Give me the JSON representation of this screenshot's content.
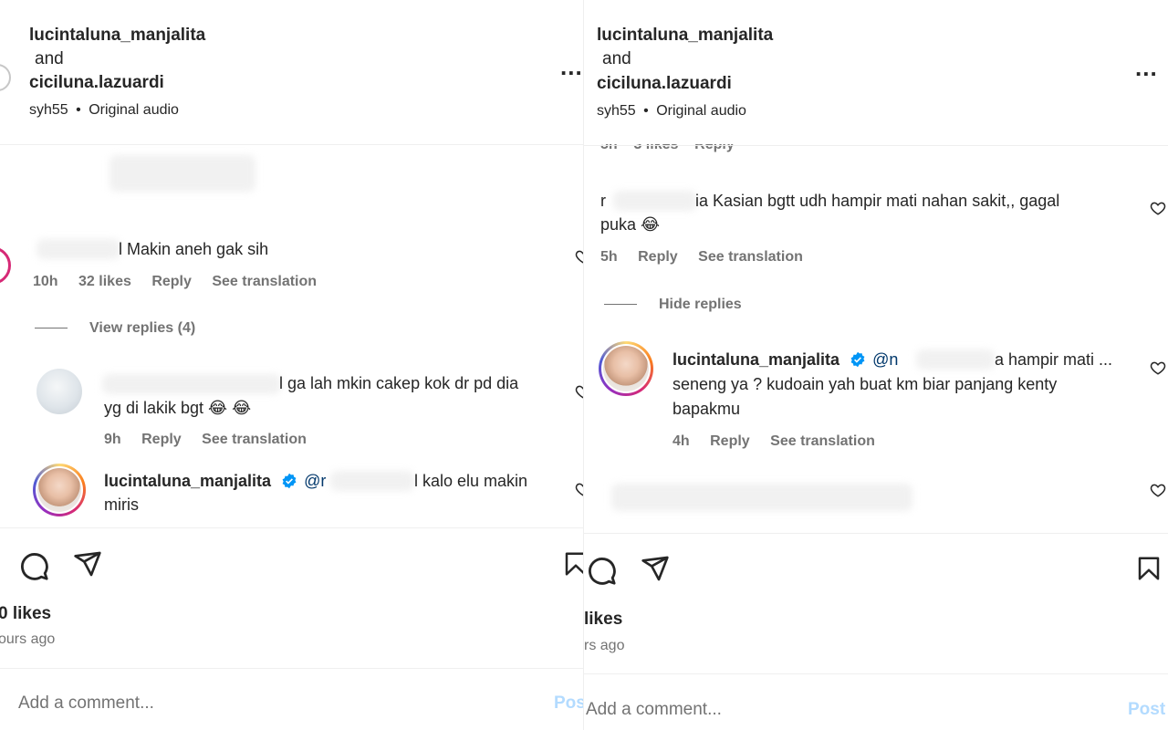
{
  "left": {
    "header": {
      "user1": "lucintaluna_manjalita",
      "and": "and",
      "user2": "ciciluna.lazuardi",
      "audio_user": "syh55",
      "audio_sep": "•",
      "audio_label": "Original audio",
      "more": "..."
    },
    "comment1": {
      "text_suffix": "l Makin aneh gak sih",
      "time": "10h",
      "likes": "32 likes",
      "reply": "Reply",
      "translate": "See translation"
    },
    "view_replies": "View replies (4)",
    "comment2": {
      "text_line1": "l ga lah mkin cakep kok dr pd dia",
      "text_line2": "yg di lakik bgt 😂 😂",
      "time": "9h",
      "reply": "Reply",
      "translate": "See translation"
    },
    "comment3": {
      "username": "lucintaluna_manjalita",
      "mention": "@r",
      "text_line1": "l kalo elu makin",
      "text_line2": "miris"
    },
    "footer": {
      "likes": "0 likes",
      "ago": "ours ago",
      "add_comment_placeholder": "Add a comment...",
      "post": "Pos"
    }
  },
  "right": {
    "header": {
      "user1": "lucintaluna_manjalita",
      "and": "and",
      "user2": "ciciluna.lazuardi",
      "audio_user": "syh55",
      "audio_sep": "•",
      "audio_label": "Original audio",
      "more": "..."
    },
    "partial_meta": "5h    3 likes    Reply",
    "comment1": {
      "text_prefix": "r",
      "text_line1": "ia Kasian bgtt udh hampir mati nahan sakit,, gagal",
      "text_line2": "puka 😂",
      "time": "5h",
      "reply": "Reply",
      "translate": "See translation"
    },
    "hide_replies": "Hide replies",
    "comment2": {
      "username": "lucintaluna_manjalita",
      "mention": "@n",
      "text_line1": "a hampir mati ...",
      "text_line2": "seneng ya ? kudoain yah buat km biar panjang kenty",
      "text_line3": "bapakmu",
      "time": "4h",
      "reply": "Reply",
      "translate": "See translation"
    },
    "footer": {
      "likes": "likes",
      "ago": "rs ago",
      "add_comment_placeholder": "Add a comment...",
      "post": "Post"
    }
  }
}
